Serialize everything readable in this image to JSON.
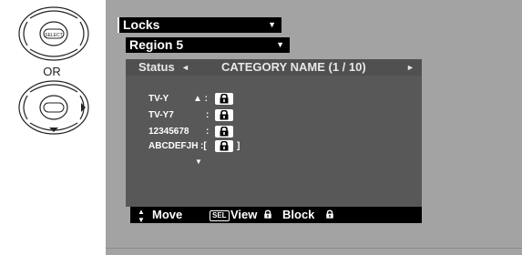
{
  "remote": {
    "or_label": "OR",
    "select_label": "SELECT"
  },
  "menu": {
    "locks_label": "Locks",
    "region_label": "Region 5",
    "dropdown_arrow": "▼"
  },
  "status": {
    "label": "Status",
    "left_arrow": "◄",
    "category": "CATEGORY NAME (1 / 10)",
    "right_arrow": "►"
  },
  "ratings": [
    {
      "name": "TV-Y",
      "prefix": "▲ :",
      "bracketed": false
    },
    {
      "name": "TV-Y7",
      "prefix": ":",
      "bracketed": false
    },
    {
      "name": "12345678",
      "prefix": ":",
      "bracketed": false
    },
    {
      "name": "ABCDEFJH",
      "prefix": ":[",
      "suffix": "]",
      "bracketed": true
    }
  ],
  "down_arrow": "▼",
  "footer": {
    "updown_glyph": "▲\n▼",
    "move_label": "Move",
    "sel_label": "SEL",
    "view_label": "View",
    "block_label": "Block"
  },
  "colors": {
    "panel_bg": "#a3a3a3",
    "status_bg": "#585858",
    "bar_bg": "#000000",
    "text": "#ffffff"
  }
}
